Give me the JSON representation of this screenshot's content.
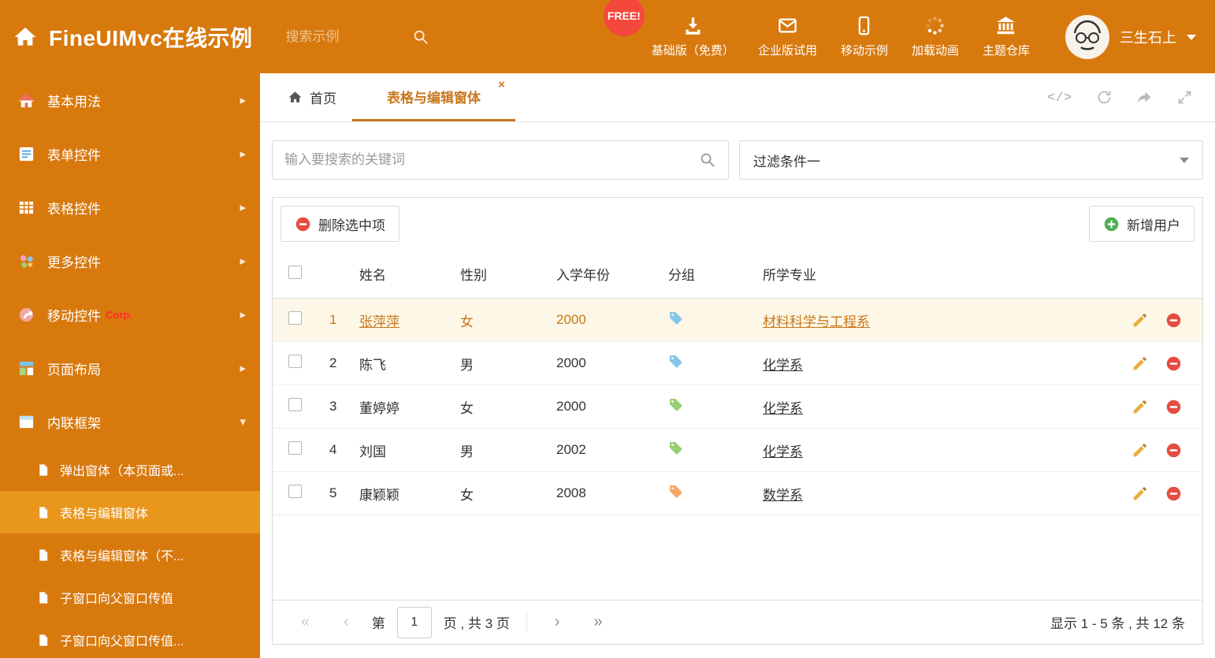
{
  "colors": {
    "header_bg": "#d8790e",
    "sidebar_selected_bg": "#e9961c",
    "accent": "#c9761a",
    "selected_row_bg": "#fcf7e6",
    "free_badge_bg": "#f5483c",
    "delete_red": "#e64c42",
    "add_green": "#4caf50"
  },
  "header": {
    "title": "FineUIMvc在线示例",
    "search_placeholder": "搜索示例",
    "free_badge": "FREE!",
    "nav": [
      {
        "label": "基础版（免费）",
        "icon": "download-icon"
      },
      {
        "label": "企业版试用",
        "icon": "envelope-icon"
      },
      {
        "label": "移动示例",
        "icon": "mobile-icon"
      },
      {
        "label": "加载动画",
        "icon": "spinner-icon"
      },
      {
        "label": "主题仓库",
        "icon": "bank-icon"
      }
    ],
    "user_name": "三生石上"
  },
  "sidebar": {
    "items": [
      {
        "label": "基本用法"
      },
      {
        "label": "表单控件"
      },
      {
        "label": "表格控件"
      },
      {
        "label": "更多控件"
      },
      {
        "label": "移动控件",
        "badge": "Corp."
      },
      {
        "label": "页面布局"
      },
      {
        "label": "内联框架",
        "expanded": true
      }
    ],
    "subitems": [
      {
        "label": "弹出窗体（本页面或..."
      },
      {
        "label": "表格与编辑窗体",
        "active": true
      },
      {
        "label": "表格与编辑窗体（不..."
      },
      {
        "label": "子窗口向父窗口传值"
      },
      {
        "label": "子窗口向父窗口传值..."
      }
    ]
  },
  "tabs": {
    "home": "首页",
    "active": "表格与编辑窗体",
    "close_glyph": "×"
  },
  "filters": {
    "search_placeholder": "输入要搜索的关键词",
    "filter_selected": "过滤条件一"
  },
  "toolbar": {
    "delete_label": "删除选中项",
    "add_label": "新增用户"
  },
  "table": {
    "columns": [
      "姓名",
      "性别",
      "入学年份",
      "分组",
      "所学专业"
    ],
    "rows": [
      {
        "num": "1",
        "name": "张萍萍",
        "gender": "女",
        "year": "2000",
        "tag": "blue",
        "major": "材料科学与工程系",
        "selected": true
      },
      {
        "num": "2",
        "name": "陈飞",
        "gender": "男",
        "year": "2000",
        "tag": "blue",
        "major": "化学系"
      },
      {
        "num": "3",
        "name": "董婷婷",
        "gender": "女",
        "year": "2000",
        "tag": "green",
        "major": "化学系"
      },
      {
        "num": "4",
        "name": "刘国",
        "gender": "男",
        "year": "2002",
        "tag": "green",
        "major": "化学系"
      },
      {
        "num": "5",
        "name": "康颖颖",
        "gender": "女",
        "year": "2008",
        "tag": "orange",
        "major": "数学系"
      }
    ]
  },
  "pagination": {
    "first": "«",
    "prev": "‹",
    "next": "›",
    "last": "»",
    "page_prefix": "第",
    "page_value": "1",
    "page_suffix": "页 , 共 3 页",
    "summary": "显示 1 - 5 条 , 共 12 条"
  }
}
